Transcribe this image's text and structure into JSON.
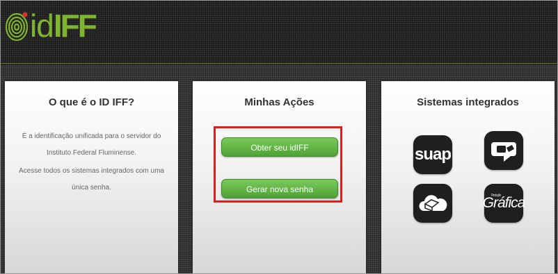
{
  "header": {
    "logo_text_id": "id",
    "logo_text_iff": "IFF",
    "colors": {
      "logo_green": "#7fb431",
      "accent_line": "#6d7a1e"
    }
  },
  "panels": {
    "about": {
      "title": "O que é o ID IFF?",
      "paragraph1": "É a identificação unificada para o servidor do Instituto Federal Fluminense.",
      "paragraph2": "Acesse todos os sistemas integrados com uma única senha."
    },
    "actions": {
      "title": "Minhas Ações",
      "obter_button": "Obter seu idIFF",
      "gerar_button": "Gerar nova senha",
      "highlight_color": "#e21b1b"
    },
    "systems": {
      "title": "Sistemas integrados",
      "apps": [
        {
          "label": "suap",
          "icon": "suap-icon"
        },
        {
          "label": "",
          "icon": "chat-bubble-icon"
        },
        {
          "label": "",
          "icon": "cloud-box-icon"
        },
        {
          "label": "Gráfica",
          "sublabel": "Produção",
          "icon": "grafica-icon"
        }
      ]
    }
  }
}
